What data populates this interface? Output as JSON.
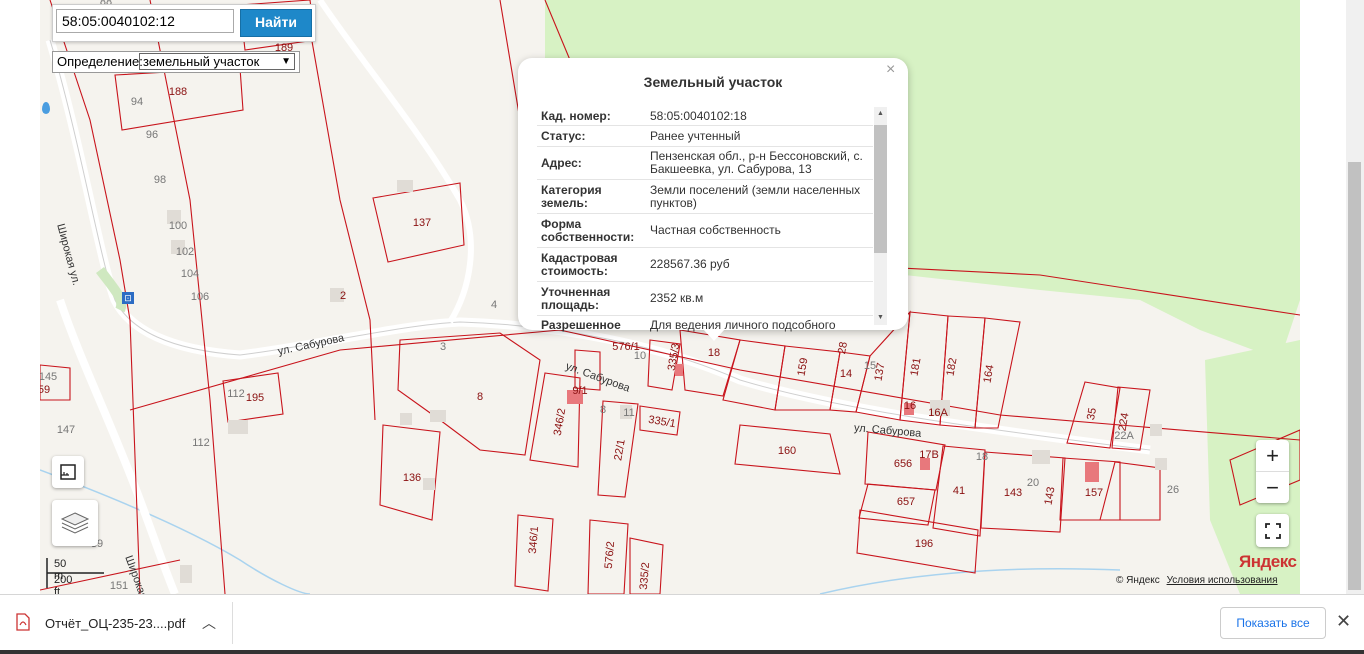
{
  "search": {
    "query": "58:05:0040102:12",
    "button_label": "Найти",
    "definition_label": "Определение:",
    "definition_value": "земельный участок"
  },
  "popup": {
    "title": "Земельный участок",
    "close_glyph": "×",
    "rows": [
      {
        "key": "Кад. номер:",
        "value": "58:05:0040102:18"
      },
      {
        "key": "Статус:",
        "value": "Ранее учтенный"
      },
      {
        "key": "Адрес:",
        "value": "Пензенская обл., р-н Бессоновский, с. Бакшеевка, ул. Сабурова, 13"
      },
      {
        "key": "Категория земель:",
        "value": "Земли поселений (земли населенных пунктов)"
      },
      {
        "key": "Форма собственности:",
        "value": "Частная собственность"
      },
      {
        "key": "Кадастровая стоимость:",
        "value": "228567.36 руб"
      },
      {
        "key": "Уточненная площадь:",
        "value": "2352 кв.м"
      },
      {
        "key": "Разрешенное",
        "value": "Для ведения личного подсобного"
      }
    ]
  },
  "map": {
    "streets": [
      "Широкая ул.",
      "ул. Сабурова",
      "ул. Сабурова",
      "ул. Сабурова",
      "Широкая"
    ],
    "parcels": [
      "189",
      "188",
      "137",
      "195",
      "8",
      "346/2",
      "22/1",
      "335/1",
      "136",
      "346/1",
      "576/2",
      "335/2",
      "160",
      "656",
      "657",
      "41",
      "143",
      "143",
      "157",
      "196",
      "35",
      "224",
      "18",
      "159",
      "28",
      "14",
      "137",
      "181",
      "182",
      "164",
      "576/1",
      "335/3",
      "2",
      "9/1",
      "17В",
      "16А",
      "16"
    ],
    "house_numbers": [
      "88",
      "94",
      "96",
      "98",
      "100",
      "102",
      "104",
      "106",
      "2",
      "4",
      "3",
      "10",
      "8",
      "11",
      "12",
      "112",
      "147",
      "145",
      "59",
      "112",
      "20",
      "22А",
      "26",
      "18",
      "15",
      "39",
      "151"
    ],
    "zoom_in": "+",
    "zoom_out": "−",
    "scale_m": "50 m",
    "scale_ft": "200 ft",
    "logo": "Яндекс",
    "copyright": "© Яндекс",
    "terms": "Условия использования",
    "colors": {
      "parcel": "#c8141c",
      "forest": "#d7f2c4",
      "road": "#ffffff",
      "water": "#a9d3ef"
    }
  },
  "downloads": {
    "file_name": "Отчёт_ОЦ-235-23....pdf",
    "show_all": "Показать все",
    "close_glyph": "✕"
  }
}
